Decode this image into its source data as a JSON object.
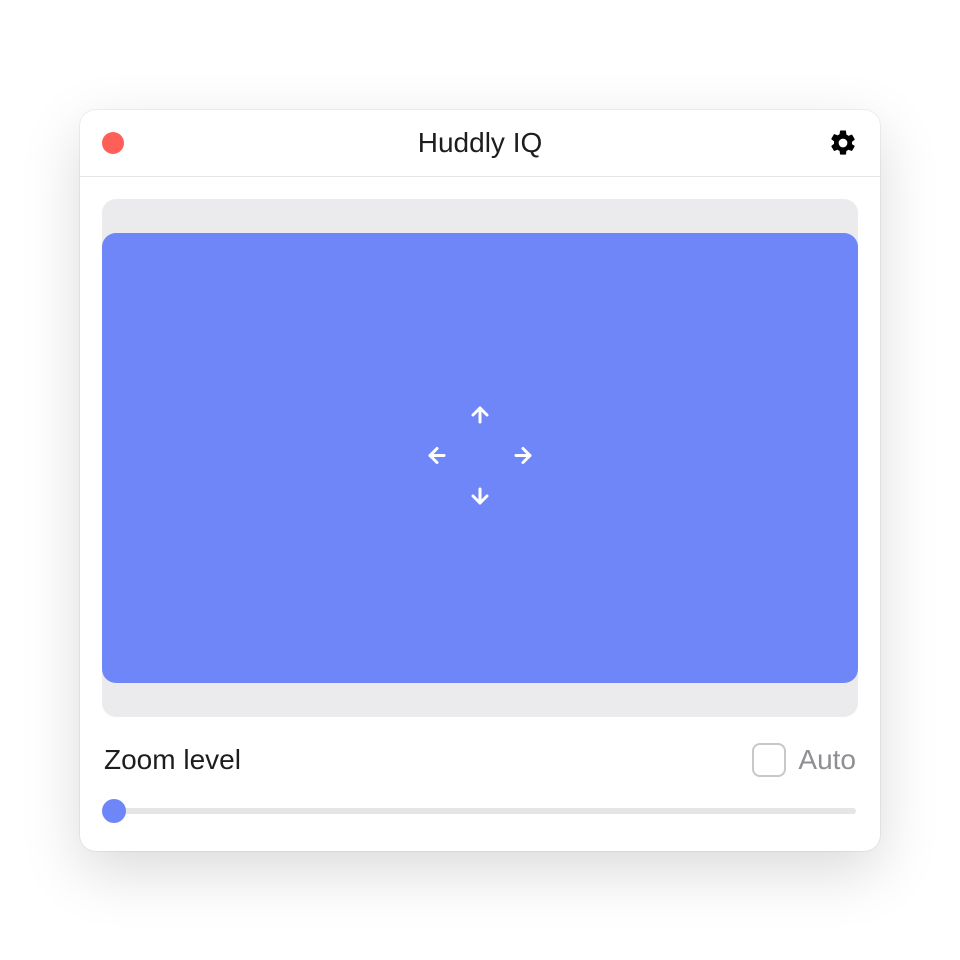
{
  "window": {
    "title": "Huddly IQ"
  },
  "zoom": {
    "label": "Zoom level",
    "auto_label": "Auto",
    "auto_checked": false,
    "slider_value": 0
  },
  "colors": {
    "accent": "#6e86f7",
    "close_button": "#ff5f57"
  }
}
